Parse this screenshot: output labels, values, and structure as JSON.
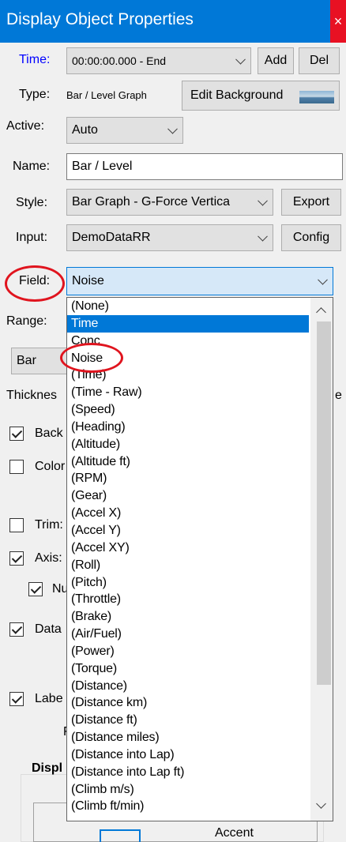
{
  "window": {
    "title": "Display Object Properties",
    "close_glyph": "×"
  },
  "time": {
    "label": "Time:",
    "value": "00:00:00.000 - End",
    "add_label": "Add",
    "del_label": "Del"
  },
  "type": {
    "label": "Type:",
    "value": "Bar / Level Graph",
    "edit_bg_label": "Edit Background"
  },
  "active": {
    "label": "Active:",
    "value": "Auto"
  },
  "name": {
    "label": "Name:",
    "value": "Bar / Level"
  },
  "style": {
    "label": "Style:",
    "value": "Bar Graph - G-Force Vertica",
    "export_label": "Export"
  },
  "input": {
    "label": "Input:",
    "value": "DemoDataRR",
    "config_label": "Config"
  },
  "field": {
    "label": "Field:",
    "value": "Noise"
  },
  "range": {
    "label": "Range:"
  },
  "bar_combo": {
    "value": "Bar"
  },
  "thickness": {
    "label": "Thicknes",
    "tail": "e"
  },
  "checks": {
    "back": {
      "label": "Back",
      "checked": true
    },
    "color": {
      "label": "Color",
      "checked": false
    },
    "trim": {
      "label": "Trim:",
      "checked": false
    },
    "axis": {
      "label": "Axis:",
      "checked": true
    },
    "nu": {
      "label": "Nu",
      "checked": true
    },
    "data": {
      "label": "Data",
      "checked": true
    },
    "labe": {
      "label": "Labe",
      "checked": true
    }
  },
  "misc": {
    "f_letter": "F",
    "displ_label": "Displ",
    "accent_label": "Accent"
  },
  "dropdown": {
    "selected_index": 1,
    "items": [
      "(None)",
      "Time",
      "Conc",
      "Noise",
      "(Time)",
      "(Time - Raw)",
      "(Speed)",
      "(Heading)",
      "(Altitude)",
      "(Altitude ft)",
      "(RPM)",
      "(Gear)",
      "(Accel X)",
      "(Accel Y)",
      "(Accel XY)",
      "(Roll)",
      "(Pitch)",
      "(Throttle)",
      "(Brake)",
      "(Air/Fuel)",
      "(Power)",
      "(Torque)",
      "(Distance)",
      "(Distance km)",
      "(Distance ft)",
      "(Distance miles)",
      "(Distance into Lap)",
      "(Distance into Lap ft)",
      "(Climb m/s)",
      "(Climb ft/min)"
    ]
  },
  "colors": {
    "titlebar": "#0078d7",
    "selection": "#0078d7",
    "annotation": "#e0141e",
    "close": "#e81123"
  }
}
